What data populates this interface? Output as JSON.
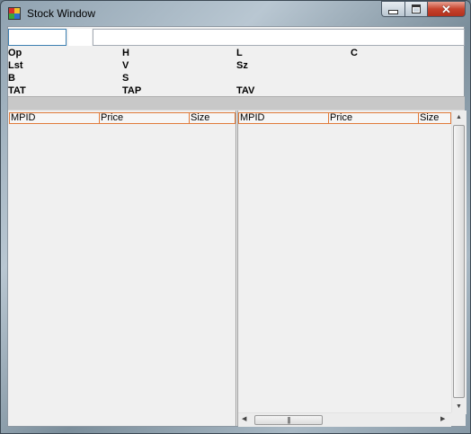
{
  "window": {
    "title": "Stock Window"
  },
  "toolbar": {
    "symbol_value": "",
    "description_value": ""
  },
  "quote": {
    "open_label": "Op",
    "high_label": "H",
    "low_label": "L",
    "close_label": "C",
    "last_label": "Lst",
    "volume_label": "V",
    "size_label": "Sz",
    "bid_label": "B",
    "ask_label": "S",
    "tat_label": "TAT",
    "tap_label": "TAP",
    "tav_label": "TAV"
  },
  "bid_book": {
    "columns": [
      "MPID",
      "Price",
      "Size"
    ]
  },
  "ask_book": {
    "columns": [
      "MPID",
      "Price",
      "Size"
    ]
  },
  "icons": {
    "app": "app-grid-icon",
    "minimize": "minimize-icon",
    "maximize": "maximize-icon",
    "close": "close-icon",
    "scroll_up": "arrow-up-icon",
    "scroll_down": "arrow-down-icon",
    "scroll_left": "arrow-left-icon",
    "scroll_right": "arrow-right-icon",
    "grip": "grip-icon"
  },
  "colors": {
    "header_border": "#e07a3a",
    "focus_border": "#3c7fb1",
    "close_button": "#c7432d"
  }
}
